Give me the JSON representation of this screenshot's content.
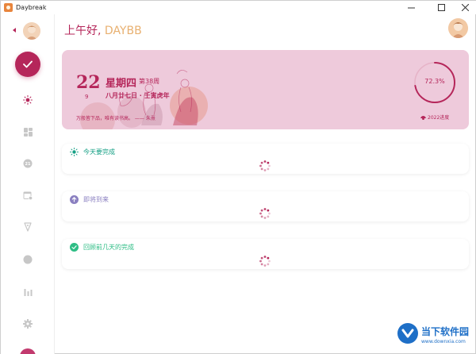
{
  "window": {
    "title": "Daybreak"
  },
  "header": {
    "greeting_prefix": "上午好, ",
    "user_name": "DAYBB"
  },
  "banner": {
    "day": "22",
    "month": "9",
    "weekday": "星期四",
    "week_number": "第38周",
    "lunar_date": "八月廿七日 · 壬寅虎年",
    "quote": "万般皆下品，唯有读书高。 —— 朱熹",
    "year_progress_percent": 72.3,
    "year_progress_text": "72.3%",
    "year_progress_label": "2022进度"
  },
  "sections": [
    {
      "title": "今天要完成",
      "color": "#16a085",
      "icon": "sun-icon"
    },
    {
      "title": "即将到来",
      "color": "#8a7fc0",
      "icon": "arrow-up-icon"
    },
    {
      "title": "回顾前几天的完成",
      "color": "#2ebd85",
      "icon": "check-circle-icon"
    }
  ],
  "sidebar": {
    "items": [
      "today-icon",
      "dashboard-icon",
      "countdown-icon",
      "calendar-icon",
      "pin-icon",
      "circle-icon",
      "stats-icon",
      "settings-icon"
    ]
  },
  "watermark": {
    "name": "当下软件园",
    "url": "www.downxia.com"
  },
  "colors": {
    "accent": "#b5265a",
    "banner_bg": "#eecadb",
    "name_color": "#e8b070"
  }
}
